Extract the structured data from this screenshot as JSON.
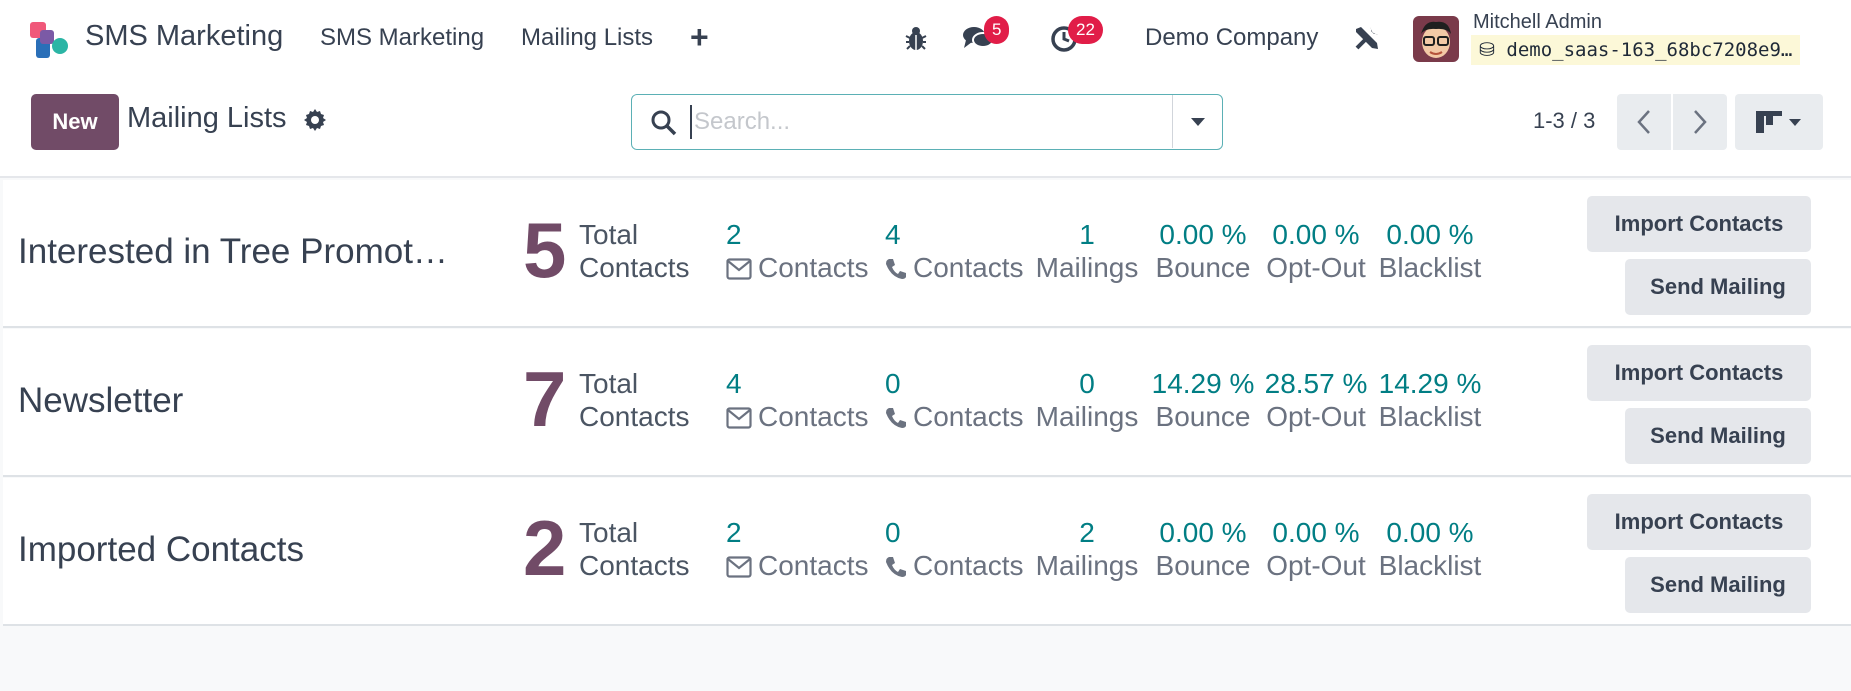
{
  "navbar": {
    "app_name": "SMS Marketing",
    "menu": [
      "SMS Marketing",
      "Mailing Lists"
    ],
    "messages_badge": "5",
    "activities_badge": "22",
    "company": "Demo Company",
    "user_name": "Mitchell Admin",
    "database": "demo_saas-163_68bc7208e9…"
  },
  "control": {
    "new_label": "New",
    "title": "Mailing Lists",
    "search_placeholder": "Search...",
    "pager": "1-3 / 3"
  },
  "labels": {
    "total": [
      "Total",
      "Contacts"
    ],
    "email_contacts": "Contacts",
    "sms_contacts": "Contacts",
    "mailings": "Mailings",
    "bounce": "Bounce",
    "optout": "Opt-Out",
    "blacklist": "Blacklist",
    "import_button": "Import Contacts",
    "send_button": "Send Mailing"
  },
  "rows": [
    {
      "name": "Interested in Tree Promot…",
      "total": "5",
      "email": "2",
      "sms": "4",
      "mailings": "1",
      "bounce": "0.00 %",
      "optout": "0.00 %",
      "blacklist": "0.00 %"
    },
    {
      "name": "Newsletter",
      "total": "7",
      "email": "4",
      "sms": "0",
      "mailings": "0",
      "bounce": "14.29 %",
      "optout": "28.57 %",
      "blacklist": "14.29 %"
    },
    {
      "name": "Imported Contacts",
      "total": "2",
      "email": "2",
      "sms": "0",
      "mailings": "2",
      "bounce": "0.00 %",
      "optout": "0.00 %",
      "blacklist": "0.00 %"
    }
  ],
  "colors": {
    "brand": "#714b67",
    "accent": "#017e84",
    "badge": "#e11d48"
  }
}
